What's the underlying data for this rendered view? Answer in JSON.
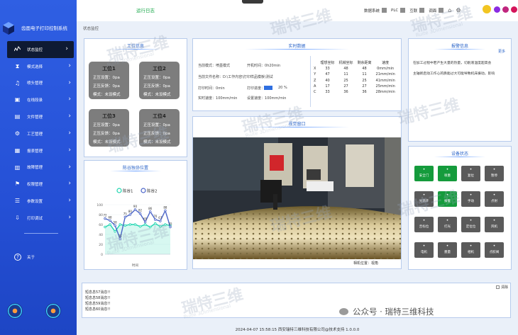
{
  "app": {
    "title": "齿面电子打印控制系统",
    "breadcrumb": "状态监控"
  },
  "topbar": {
    "green_text": "运行日志",
    "data_sys": "数据系统",
    "plc": "PLC",
    "network": "互联",
    "proc": "调面"
  },
  "sidebar": {
    "items": [
      {
        "label": "状态监控",
        "icon": "chart"
      },
      {
        "label": "模式选择",
        "icon": "hourglass"
      },
      {
        "label": "喷头管理",
        "icon": "bell"
      },
      {
        "label": "在线段录",
        "icon": "monitor"
      },
      {
        "label": "文件管理",
        "icon": "folder"
      },
      {
        "label": "工艺管理",
        "icon": "nodes"
      },
      {
        "label": "报表管理",
        "icon": "report"
      },
      {
        "label": "故障管理",
        "icon": "clip"
      },
      {
        "label": "权限管理",
        "icon": "flag"
      },
      {
        "label": "参数设置",
        "icon": "sliders"
      },
      {
        "label": "打印调试",
        "icon": "download"
      }
    ],
    "about": "关于"
  },
  "stations": {
    "title": "工位信息",
    "items": [
      {
        "name": "工位1",
        "l1": "正压设置：0pa",
        "l2": "正压反馈：0pa",
        "l3": "模式：未设模式"
      },
      {
        "name": "工位2",
        "l1": "正压设置：0pa",
        "l2": "正压反馈：0pa",
        "l3": "模式：未设模式"
      },
      {
        "name": "工位3",
        "l1": "正压设置：0pa",
        "l2": "正压反馈：0pa",
        "l3": "模式：未设模式"
      },
      {
        "name": "工位4",
        "l1": "正压设置：0pa",
        "l2": "正压反馈：0pa",
        "l3": "模式：未设模式"
      }
    ]
  },
  "realtime": {
    "title": "实时数据",
    "current_mode": "当前模式：",
    "mode_value": "喷墨模式",
    "on_time": "开机时间：",
    "on_time_value": "0h20min",
    "current_file": "当前文件名称：",
    "file_value": "D:\\工作内容\\打印样品模板\\测试",
    "print_time": "打印时间：",
    "print_time_value": "0min",
    "print_progress": "打印进度：",
    "progress_pct": "20 %",
    "progress": 0.2,
    "real_speed": "实时速度：",
    "real_speed_value": "100mm/min",
    "set_speed": "设置速度：",
    "set_speed_value": "100mm/min"
  },
  "coords": {
    "headers": [
      "",
      "理想坐标",
      "机械坐标",
      "剩余距离",
      "速度"
    ],
    "rows": [
      [
        "X",
        "33",
        "48",
        "48",
        "0mm/min"
      ],
      [
        "Y",
        "47",
        "11",
        "11",
        "21mm/min"
      ],
      [
        "Z",
        "40",
        "25",
        "25",
        "41mm/min"
      ],
      [
        "A",
        "17",
        "27",
        "27",
        "25mm/min"
      ],
      [
        "C",
        "33",
        "36",
        "36",
        "28mm/min"
      ]
    ]
  },
  "alarm": {
    "title": "报警信息",
    "more": "更多",
    "lines": [
      "在加工过程中若产生大量的热量，切削液温度超高会",
      "主轴新启动工作心的质能过大可能导致机床振动，影响"
    ]
  },
  "camera": {
    "title": "视觉窗口",
    "label": "相机位置：视角"
  },
  "chart_data": {
    "type": "line",
    "title": "陈谷独协位置",
    "series": [
      {
        "name": "陈谷1",
        "color": "#1fd6b0",
        "values": [
          55,
          60,
          46,
          60,
          58,
          60,
          60,
          56,
          60,
          55,
          62,
          56,
          60,
          58
        ]
      },
      {
        "name": "陈谷2",
        "color": "#4a64c8",
        "values": [
          72,
          68,
          58,
          31,
          75,
          80,
          90,
          82,
          65,
          86,
          70,
          67,
          88,
          55
        ]
      }
    ],
    "ylim": [
      0,
      100
    ],
    "yticks": [
      0,
      20,
      40,
      60,
      80,
      100
    ],
    "xlabel": "时间"
  },
  "device": {
    "title": "设备状态",
    "buttons": [
      {
        "label": "安全门",
        "green": true
      },
      {
        "label": "喷墨",
        "green": true
      },
      {
        "label": "复位",
        "green": false
      },
      {
        "label": "暂停",
        "green": false
      },
      {
        "label": "光源开",
        "green": false
      },
      {
        "label": "报警",
        "green": true
      },
      {
        "label": "手动",
        "green": false
      },
      {
        "label": "点射",
        "green": false
      },
      {
        "label": "舌标位",
        "green": false
      },
      {
        "label": "打光",
        "green": false
      },
      {
        "label": "定位位",
        "green": false
      },
      {
        "label": "风机",
        "green": false
      },
      {
        "label": "电机",
        "green": false
      },
      {
        "label": "墨量",
        "green": false
      },
      {
        "label": "相机",
        "green": false
      },
      {
        "label": "点胶阀",
        "green": false
      }
    ]
  },
  "messages": {
    "clear": "清除",
    "lines": [
      "短息息57消息!!",
      "短息息58消息!!",
      "短息息59消息!!",
      "短息息60消息!!"
    ]
  },
  "footer": "2024-04-07 15:58:15   西安瑞特三维科技有限公司@技术支持 1.0.0.0",
  "watermark": {
    "text": "瑞特三维",
    "sub": "Ruite 3Dimensional",
    "wechat": "公众号 · 瑞特三维科技"
  }
}
